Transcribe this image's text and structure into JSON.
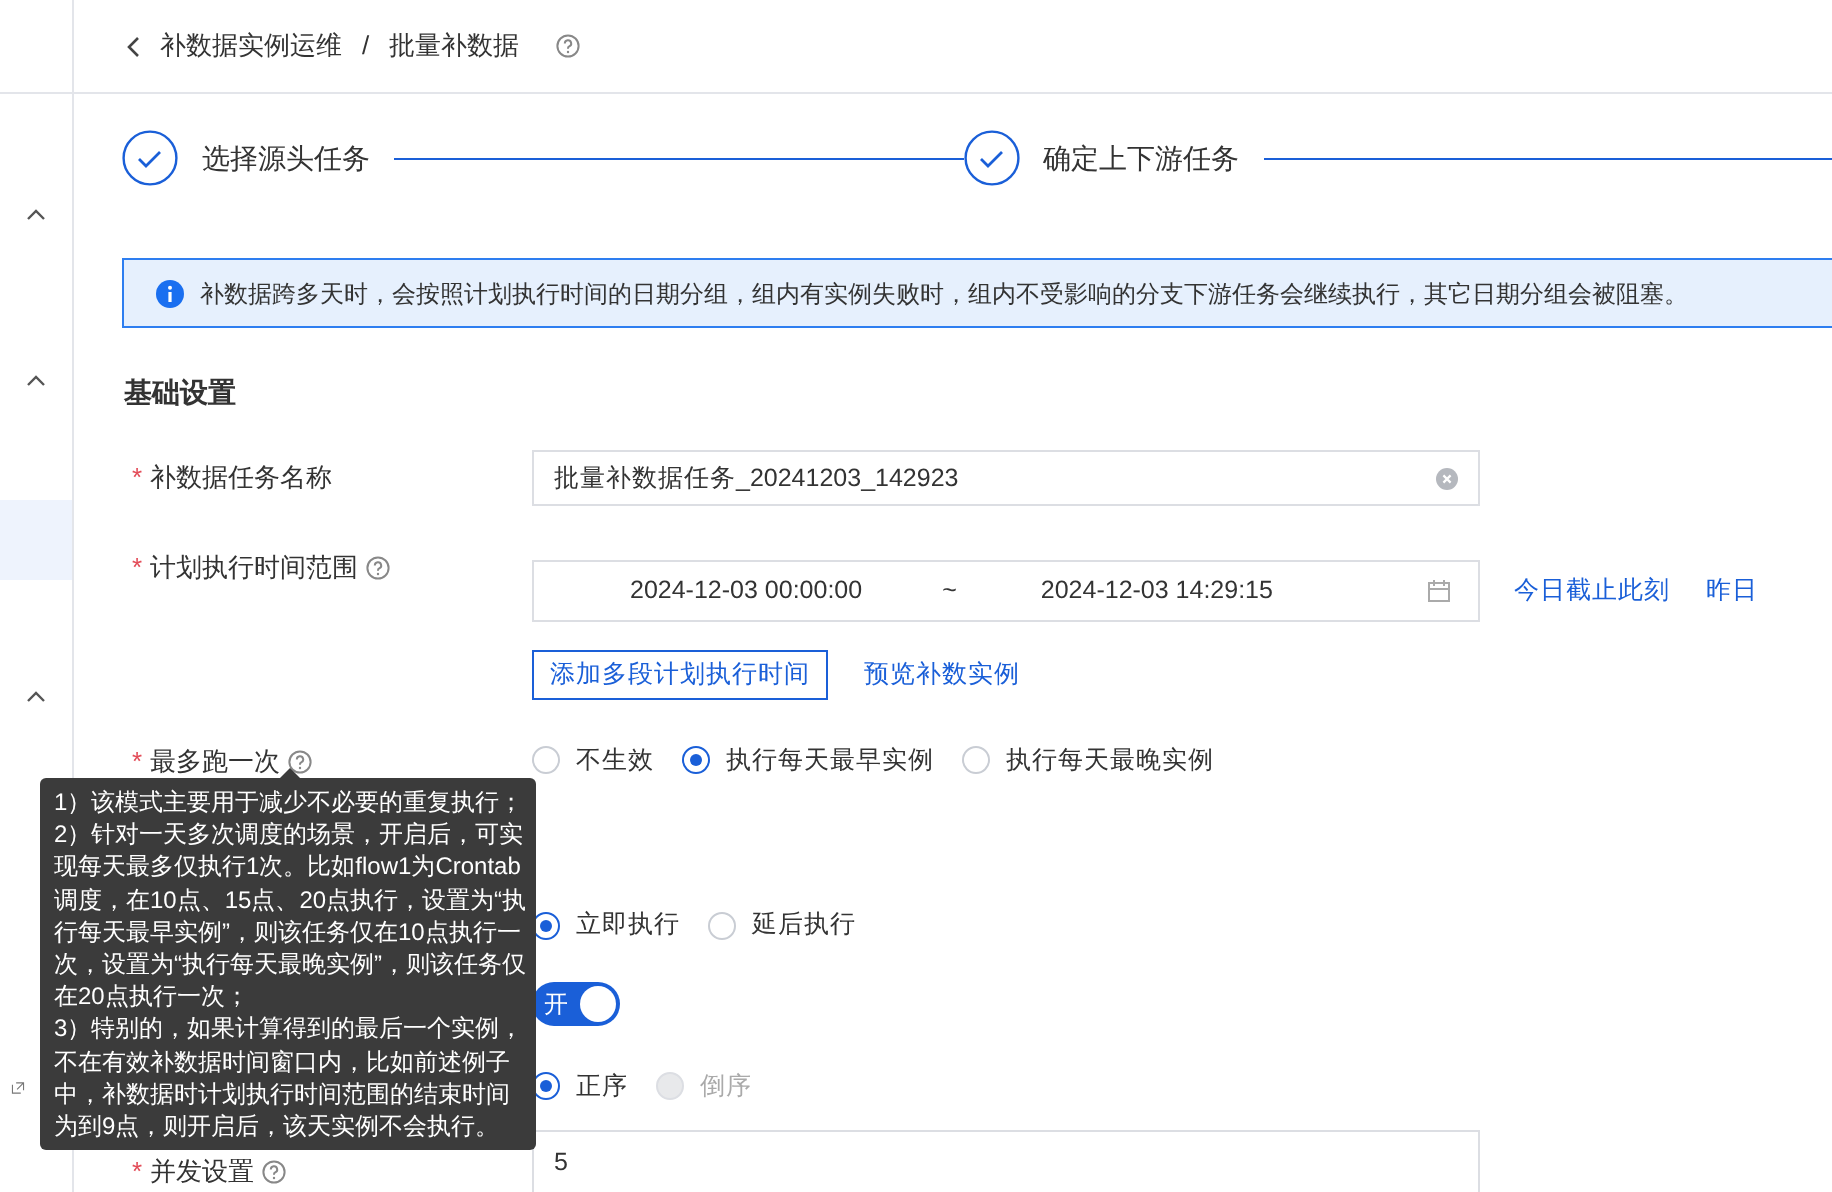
{
  "sidebar": {
    "items": [
      {
        "kind": "chevron",
        "selected": false
      },
      {
        "kind": "chevron",
        "selected": false
      },
      {
        "kind": "blank",
        "selected": true
      },
      {
        "kind": "chevron",
        "selected": false
      },
      {
        "kind": "export",
        "selected": false
      }
    ]
  },
  "breadcrumb": {
    "items": [
      "补数据实例运维",
      "批量补数据"
    ],
    "separator": "/"
  },
  "steps": [
    {
      "label": "选择源头任务",
      "done": true
    },
    {
      "label": "确定上下游任务",
      "done": true
    }
  ],
  "alert": {
    "text": "补数据跨多天时，会按照计划执行时间的日期分组，组内有实例失败时，组内不受影响的分支下游任务会继续执行，其它日期分组会被阻塞。"
  },
  "section_title": "基础设置",
  "fields": [
    {
      "kind": "text",
      "mark": "*",
      "label": "补数据任务名称",
      "help": false,
      "value": "批量补数据任务_20241203_142923"
    },
    {
      "kind": "range",
      "mark": "*",
      "label": "计划执行时间范围",
      "help": true,
      "start": "2024-12-03 00:00:00",
      "separator": "~",
      "end": "2024-12-03 14:29:15",
      "shortcuts": [
        "今日截止此刻",
        "昨日"
      ],
      "add_button": "添加多段计划执行时间",
      "preview_link": "预览补数实例"
    },
    {
      "kind": "radio",
      "mark": "*",
      "label": "最多跑一次",
      "help": true,
      "options": [
        {
          "label": "不生效",
          "selected": false,
          "disabled": false
        },
        {
          "label": "执行每天最早实例",
          "selected": true,
          "disabled": false
        },
        {
          "label": "执行每天最晚实例",
          "selected": false,
          "disabled": false
        }
      ]
    },
    {
      "kind": "radio",
      "options": [
        {
          "label": "立即执行",
          "selected": true,
          "disabled": false
        },
        {
          "label": "延后执行",
          "selected": false,
          "disabled": false
        }
      ]
    },
    {
      "kind": "switch",
      "on": true,
      "text": "开"
    },
    {
      "kind": "radio",
      "options": [
        {
          "label": "正序",
          "selected": true,
          "disabled": false
        },
        {
          "label": "倒序",
          "selected": false,
          "disabled": true
        }
      ]
    },
    {
      "kind": "number",
      "mark": "*",
      "label": "并发设置",
      "help": true,
      "value": "5"
    }
  ],
  "tooltip": {
    "paragraphs": [
      "1）该模式主要用于减少不必要的重复执行；",
      "2）针对一天多次调度的场景，开启后，可实现每天最多仅执行1次。比如flow1为Crontab调度，在10点、15点、20点执行，设置为“执行每天最早实例”，则该任务仅在10点执行一次，设置为“执行每天最晚实例”，则该任务仅在20点执行一次；",
      "3）特别的，如果计算得到的最后一个实例，不在有效补数据时间窗口内，比如前述例子中，补数据时计划执行时间范围的结束时间为到9点，则开启后，该天实例不会执行。"
    ]
  }
}
